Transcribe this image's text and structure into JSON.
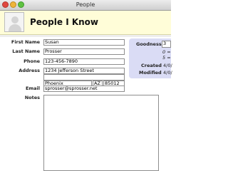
{
  "window": {
    "title": "People"
  },
  "header": {
    "title": "People I Know"
  },
  "form": {
    "first_name": {
      "label": "First Name",
      "value": "Susan"
    },
    "last_name": {
      "label": "Last Name",
      "value": "Prosser"
    },
    "phone": {
      "label": "Phone",
      "value": "123-456-7890"
    },
    "address": {
      "label": "Address",
      "street": "1234 Jefferson Street",
      "street2": "",
      "city": "Phoenix",
      "state": "AZ",
      "zip": "85012"
    },
    "email": {
      "label": "Email",
      "value": "sprosser@sprosser.net"
    },
    "notes": {
      "label": "Notes",
      "value": ""
    }
  },
  "goodness": {
    "label": "Goodness",
    "value": "3",
    "scale_low": "0 =",
    "scale_high": "5 ="
  },
  "record_info": {
    "created_label": "Created",
    "created_value": "4/0/",
    "modified_label": "Modified",
    "modified_value": "4/0/"
  },
  "colors": {
    "header_bg": "#fffdd8",
    "goodness_panel_bg": "#dadcf5"
  }
}
